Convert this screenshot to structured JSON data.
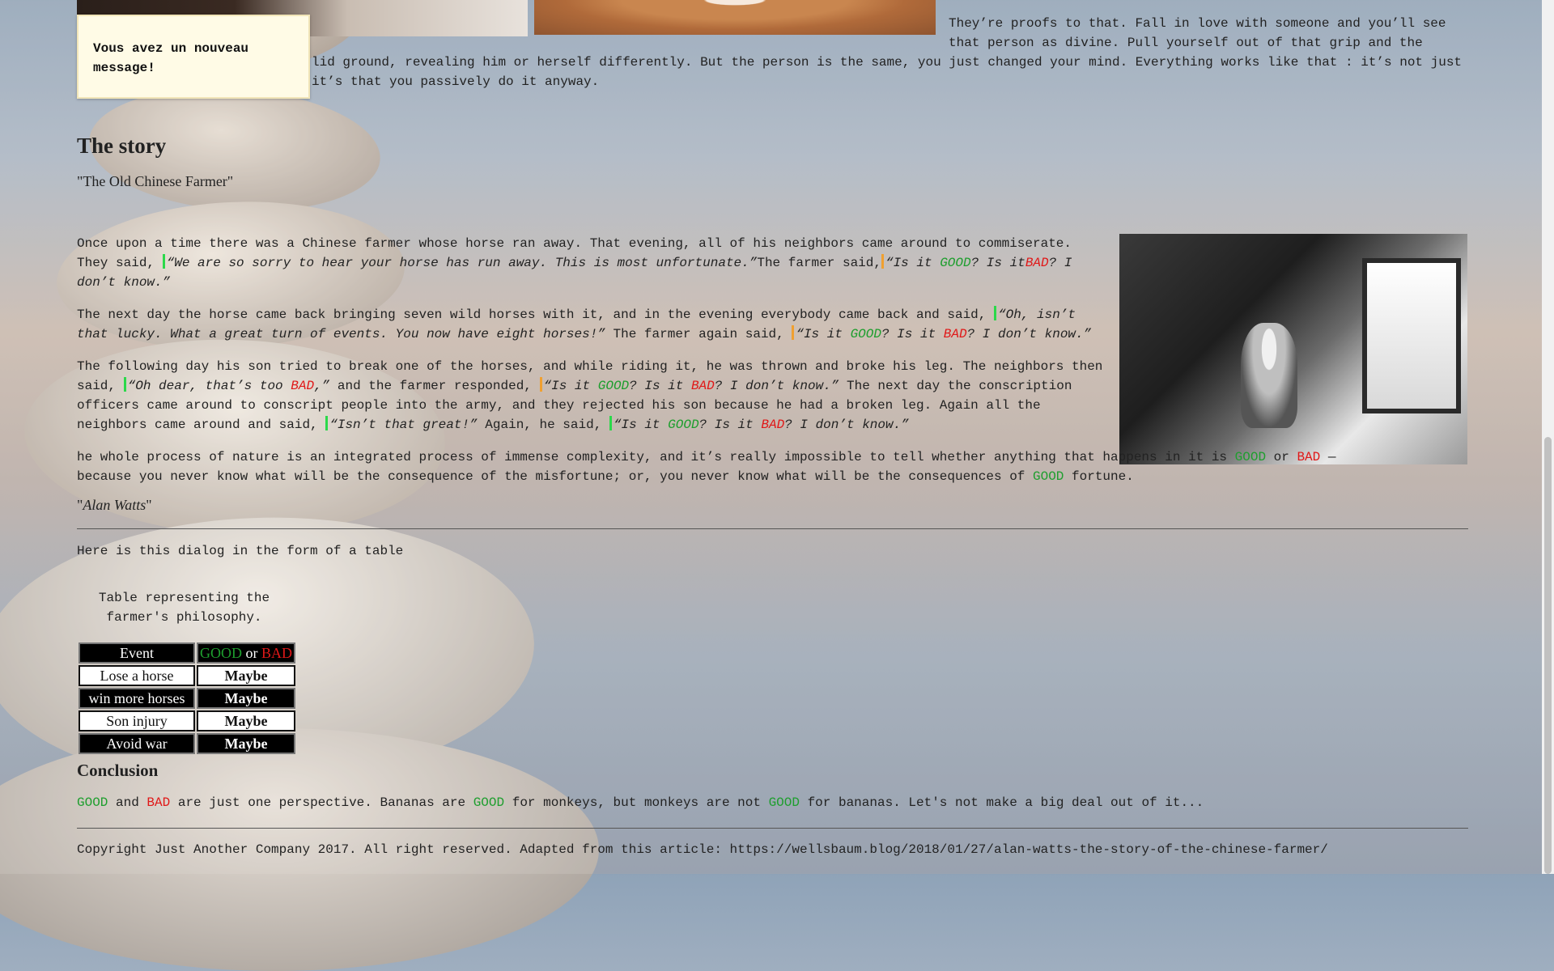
{
  "toast": {
    "message": "Vous avez un nouveau message!"
  },
  "intro": {
    "line1": "They’re proofs to that. Fall in love with someone and you’ll see",
    "line2": "that person as divine. Pull yourself out of that grip and the",
    "line3": "lid ground, revealing him or herself differently. But the person is the same, you just changed your mind. Everything works like that : it’s not just",
    "line4": "it’s that you passively do it anyway."
  },
  "story": {
    "heading": "The story",
    "subtitle": "\"The Old Chinese Farmer\"",
    "good": "GOOD",
    "bad": "BAD",
    "p1_a": "Once upon a time there was a Chinese farmer whose horse ran away. That evening, all of his neighbors came around to commiserate. They said, ",
    "p1_q1": "“We are so sorry to hear your horse has run away. This is most unfortunate.”",
    "p1_b": "The farmer said,",
    "p1_q2a": "“Is it ",
    "p1_q2b": "? Is it",
    "p1_q2c": "? I don’t know.”",
    "p2_a": "The next day the horse came back bringing seven wild horses with it, and in the evening everybody came back and said, ",
    "p2_q1": "“Oh, isn’t that lucky. What a great turn of events. You now have eight horses!”",
    "p2_b": " The farmer again said, ",
    "p2_q2a": "“Is it ",
    "p2_q2b": "? Is it ",
    "p2_q2c": "? I don’t know.”",
    "p3_a": "The following day his son tried to break one of the horses, and while riding it, he was thrown and broke his leg. The neighbors then said, ",
    "p3_q1a": "“Oh dear, that’s too ",
    "p3_q1b": ",”",
    "p3_b": " and the farmer responded, ",
    "p3_q2a": "“Is it ",
    "p3_q2b": "? Is it ",
    "p3_q2c": "? I don’t know.”",
    "p3_c": " The next day the conscription officers came around to conscript people into the army, and they rejected his son because he had a broken leg. Again all the neighbors came around and said, ",
    "p3_q3": "“Isn’t that great!”",
    "p3_d": " Again, he said, ",
    "p3_q4a": "“Is it ",
    "p3_q4b": "? Is it ",
    "p3_q4c": "? I don’t know.”",
    "p4_a": "he whole process of nature is an integrated process of immense complexity, and it’s really impossible to tell whether anything that happens in it is ",
    "p4_b": " or ",
    "p4_c": " — because you never know what will be the consequence of the misfortune; or, you never know what will be the consequences of ",
    "p4_d": " fortune.",
    "sig_open": "\"",
    "sig_name": "Alan Watts",
    "sig_close": "\""
  },
  "table_section": {
    "intro": "Here is this dialog in the form of a table",
    "caption": "Table representing the farmer's philosophy.",
    "header_event": "Event",
    "header_good": "GOOD",
    "header_or": " or ",
    "header_bad": "BAD",
    "rows": [
      {
        "event": "Lose a horse",
        "verdict": "Maybe"
      },
      {
        "event": "win more horses",
        "verdict": "Maybe"
      },
      {
        "event": "Son injury",
        "verdict": "Maybe"
      },
      {
        "event": "Avoid war",
        "verdict": "Maybe"
      }
    ]
  },
  "conclusion": {
    "heading": "Conclusion",
    "good": "GOOD",
    "bad": "BAD",
    "t1": " and ",
    "t2": " are just one perspective. Bananas are ",
    "t3": " for monkeys, but monkeys are not ",
    "t4": " for bananas. Let's not make a big deal out of it..."
  },
  "footer": {
    "copyright": "Copyright Just Another Company 2017. All right reserved. Adapted from this article: https://wellsbaum.blog/2018/01/27/alan-watts-the-story-of-the-chinese-farmer/"
  },
  "colors": {
    "good": "#1e9e2e",
    "bad": "#e01818",
    "quote_bar_green": "#2bd94a",
    "quote_bar_orange": "#f0a030"
  }
}
